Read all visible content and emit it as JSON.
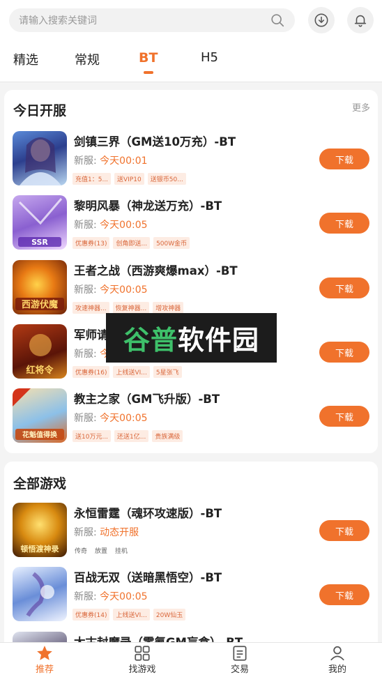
{
  "search": {
    "placeholder": "请输入搜索关键词"
  },
  "tabs": [
    {
      "label": "精选"
    },
    {
      "label": "常规"
    },
    {
      "label": "BT"
    },
    {
      "label": "H5"
    }
  ],
  "today": {
    "title": "今日开服",
    "more": "更多",
    "games": [
      {
        "name": "剑镇三界（GM送10万充）-BT",
        "server_label": "新服:",
        "server_time": "今天00:01",
        "tags": [
          "充值1：5...",
          "送VIP10",
          "送银币50..."
        ],
        "button": "下载"
      },
      {
        "name": "黎明风暴（神龙送万充）-BT",
        "server_label": "新服:",
        "server_time": "今天00:05",
        "tags": [
          "优惠券(13)",
          "创角即送...",
          "500W金币"
        ],
        "button": "下载"
      },
      {
        "name": "王者之战（西游爽爆max）-BT",
        "server_label": "新服:",
        "server_time": "今天00:05",
        "tags": [
          "攻速神器...",
          "恢复神器...",
          "增攻神器"
        ],
        "button": "下载"
      },
      {
        "name": "军师请",
        "server_label": "新服:",
        "server_time": "今",
        "tags": [
          "优惠券(16)",
          "上线送VI...",
          "5星张飞"
        ],
        "button": "下载"
      },
      {
        "name": "教主之家（GM飞升版）-BT",
        "server_label": "新服:",
        "server_time": "今天00:05",
        "tags": [
          "送10万元...",
          "还送1亿...",
          "贵族满级"
        ],
        "button": "下载"
      }
    ]
  },
  "all": {
    "title": "全部游戏",
    "games": [
      {
        "name": "永恒雷霆（魂环攻速版）-BT",
        "server_label": "新服:",
        "server_time": "动态开服",
        "tags": [
          "传奇",
          "放置",
          "挂机"
        ],
        "button": "下载"
      },
      {
        "name": "百战无双（送暗黑悟空）-BT",
        "server_label": "新服:",
        "server_time": "今天00:05",
        "tags": [
          "优惠券(14)",
          "上线送VI...",
          "20W仙玉"
        ],
        "button": "下载"
      },
      {
        "name": "太古封魔录（零氪GM盲盒）-BT"
      }
    ]
  },
  "watermark": {
    "part1": "谷普",
    "part2": "软件园"
  },
  "nav": [
    {
      "label": "推荐"
    },
    {
      "label": "找游戏"
    },
    {
      "label": "交易"
    },
    {
      "label": "我的"
    }
  ],
  "colors": {
    "accent": "#f0722c",
    "tag_bg": "#fdece3",
    "watermark_green": "#3ec06a"
  }
}
